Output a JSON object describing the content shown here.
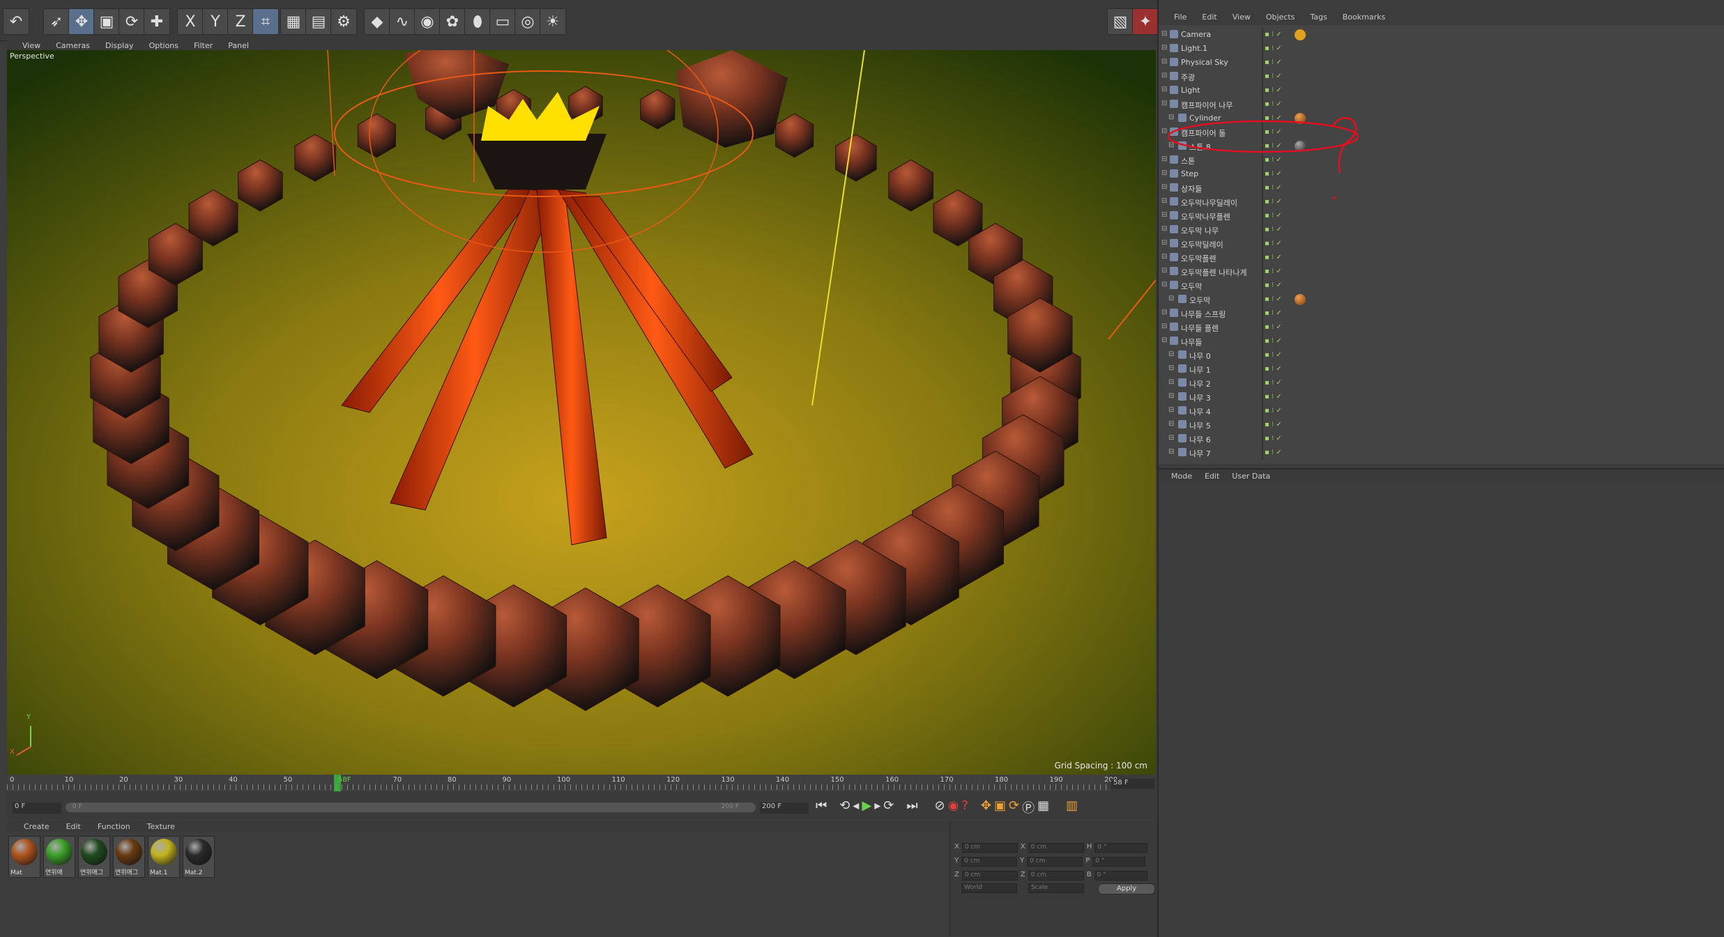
{
  "topbar": {
    "axis_x": "X",
    "axis_y": "Y",
    "axis_z": "Z"
  },
  "viewport": {
    "menu": [
      "View",
      "Cameras",
      "Display",
      "Options",
      "Filter",
      "Panel"
    ],
    "label": "Perspective",
    "grid_spacing": "Grid Spacing : 100 cm",
    "axis_y": "Y",
    "axis_x": "X"
  },
  "timeline": {
    "ticks": [
      "0",
      "10",
      "20",
      "30",
      "40",
      "50",
      "58F",
      "70",
      "80",
      "90",
      "100",
      "110",
      "120",
      "130",
      "140",
      "150",
      "160",
      "170",
      "180",
      "190",
      "200"
    ],
    "current_frame": "58 F",
    "start_frame": "0 F",
    "start_small": "0 F",
    "end_small": "200 F",
    "end_frame": "200 F"
  },
  "materials": {
    "menu": [
      "Create",
      "Edit",
      "Function",
      "Texture"
    ],
    "items": [
      {
        "label": "Mat",
        "color": "#b0541c"
      },
      {
        "label": "연위애",
        "color": "#3aa028"
      },
      {
        "label": "연위애그",
        "color": "#1f4a1f"
      },
      {
        "label": "연위애그",
        "color": "#6a3a10"
      },
      {
        "label": "Mat.1",
        "color": "#c4b41e"
      },
      {
        "label": "Mat.2",
        "color": "#2a2a2a"
      }
    ]
  },
  "coords": {
    "x_label": "X",
    "y_label": "Y",
    "z_label": "Z",
    "h_label": "H",
    "p_label": "P",
    "b_label": "B",
    "pos_x": "0 cm",
    "pos_y": "0 cm",
    "pos_z": "0 cm",
    "size_x": "0 cm",
    "size_y": "0 cm",
    "size_z": "0 cm",
    "rot_h": "0 °",
    "rot_p": "0 °",
    "rot_b": "0 °",
    "world": "World",
    "scale": "Scale",
    "apply": "Apply"
  },
  "object_manager": {
    "menu": [
      "File",
      "Edit",
      "View",
      "Objects",
      "Tags",
      "Bookmarks"
    ],
    "objects": [
      {
        "name": "Camera",
        "indent": 0
      },
      {
        "name": "Light.1",
        "indent": 0
      },
      {
        "name": "Physical Sky",
        "indent": 0
      },
      {
        "name": "주광",
        "indent": 0
      },
      {
        "name": "Light",
        "indent": 0
      },
      {
        "name": "캠프파이어 나무",
        "indent": 0
      },
      {
        "name": "Cylinder",
        "indent": 1
      },
      {
        "name": "캠프파이어 돌",
        "indent": 0
      },
      {
        "name": "스톤.8",
        "indent": 1
      },
      {
        "name": "스톤",
        "indent": 0
      },
      {
        "name": "Step",
        "indent": 0
      },
      {
        "name": "상자들",
        "indent": 0
      },
      {
        "name": "오두막나무딜레이",
        "indent": 0
      },
      {
        "name": "오두막나무플렌",
        "indent": 0
      },
      {
        "name": "오두막 나무",
        "indent": 0
      },
      {
        "name": "오두막딜레이",
        "indent": 0
      },
      {
        "name": "오두막플렌",
        "indent": 0
      },
      {
        "name": "오두막플렌 나타나게",
        "indent": 0
      },
      {
        "name": "오두막",
        "indent": 0
      },
      {
        "name": "오두막",
        "indent": 1
      },
      {
        "name": "나무들 스프링",
        "indent": 0
      },
      {
        "name": "나무들 플렌",
        "indent": 0
      },
      {
        "name": "나무들",
        "indent": 0
      },
      {
        "name": "나무 0",
        "indent": 1
      },
      {
        "name": "나무 1",
        "indent": 1
      },
      {
        "name": "나무 2",
        "indent": 1
      },
      {
        "name": "나무 3",
        "indent": 1
      },
      {
        "name": "나무 4",
        "indent": 1
      },
      {
        "name": "나무 5",
        "indent": 1
      },
      {
        "name": "나무 6",
        "indent": 1
      },
      {
        "name": "나무 7",
        "indent": 1
      }
    ]
  },
  "attributes": {
    "menu": [
      "Mode",
      "Edit",
      "User Data"
    ]
  }
}
